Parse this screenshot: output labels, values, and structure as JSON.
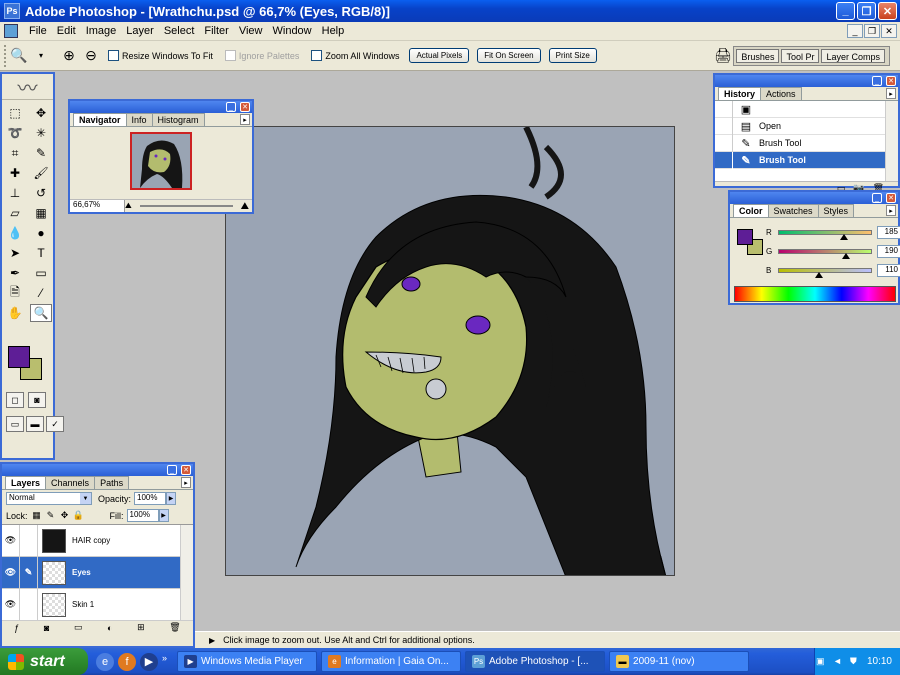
{
  "window": {
    "title": "Adobe Photoshop - [Wrathchu.psd @ 66,7% (Eyes, RGB/8)]"
  },
  "menu": [
    "File",
    "Edit",
    "Image",
    "Layer",
    "Select",
    "Filter",
    "View",
    "Window",
    "Help"
  ],
  "options_bar": {
    "resize_windows": "Resize Windows To Fit",
    "ignore_palettes": "Ignore Palettes",
    "zoom_all": "Zoom All Windows",
    "actual_pixels": "Actual Pixels",
    "fit_on_screen": "Fit On Screen",
    "print_size": "Print Size",
    "palette_well": [
      "Brushes",
      "Tool Pr",
      "Layer Comps"
    ]
  },
  "navigator": {
    "tabs": [
      "Navigator",
      "Info",
      "Histogram"
    ],
    "zoom": "66,67%"
  },
  "history": {
    "tabs": [
      "History",
      "Actions"
    ],
    "items": [
      "Open",
      "Brush Tool",
      "Brush Tool"
    ],
    "selected_index": 2
  },
  "color": {
    "tabs": [
      "Color",
      "Swatches",
      "Styles"
    ],
    "channels": [
      {
        "label": "R",
        "value": "185",
        "level": 0.725
      },
      {
        "label": "G",
        "value": "190",
        "level": 0.745
      },
      {
        "label": "B",
        "value": "110",
        "level": 0.431
      }
    ],
    "foreground": "#5e1e96",
    "background": "#b9be6e"
  },
  "layers": {
    "tabs": [
      "Layers",
      "Channels",
      "Paths"
    ],
    "blend_mode": "Normal",
    "opacity_label": "Opacity:",
    "opacity": "100%",
    "lock_label": "Lock:",
    "fill_label": "Fill:",
    "fill": "100%",
    "items": [
      {
        "name": "HAIR copy",
        "selected": false
      },
      {
        "name": "Eyes",
        "selected": true
      },
      {
        "name": "Skin 1",
        "selected": false
      }
    ]
  },
  "status": {
    "text": "Click image to zoom out. Use Alt and Ctrl for additional options."
  },
  "taskbar": {
    "start": "start",
    "tasks": [
      "Windows Media Player",
      "Information | Gaia On...",
      "Adobe Photoshop - [...",
      "2009-11 (nov)"
    ],
    "active_task": 2,
    "clock": "10:10"
  },
  "colors": {
    "canvas_bg": "#9aa4b4",
    "skin": "#b3bc6e",
    "hair": "#151515",
    "eyes": "#6a28c0"
  }
}
